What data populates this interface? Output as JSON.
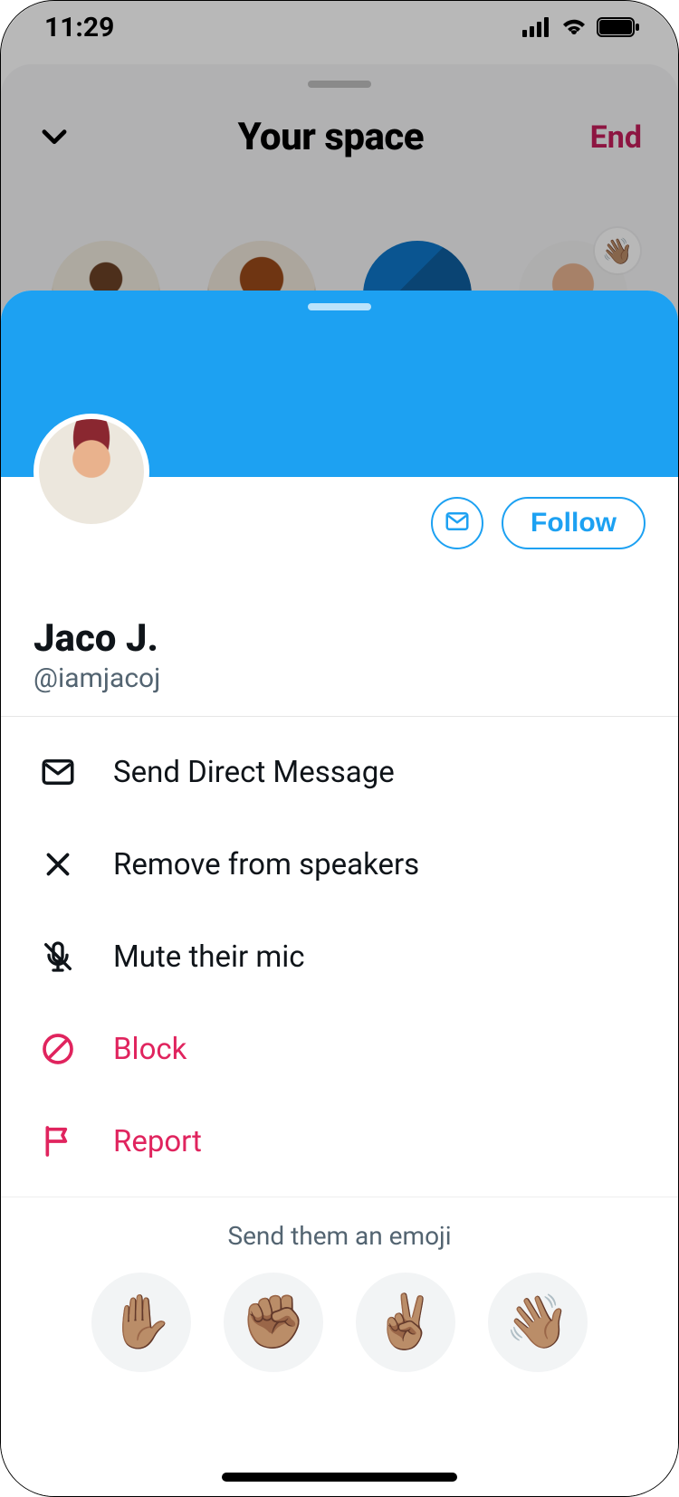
{
  "status": {
    "time": "11:29"
  },
  "space": {
    "title": "Your space",
    "end_label": "End",
    "wave_emoji": "👋🏽"
  },
  "profile": {
    "display_name": "Jaco J.",
    "handle": "@iamjacoj",
    "follow_label": "Follow"
  },
  "menu": {
    "dm": "Send Direct Message",
    "remove": "Remove from speakers",
    "mute": "Mute their mic",
    "block": "Block",
    "report": "Report"
  },
  "emoji_section": {
    "prompt": "Send them an emoji",
    "items": [
      "✋🏽",
      "✊🏽",
      "✌🏽",
      "👋🏽"
    ]
  }
}
